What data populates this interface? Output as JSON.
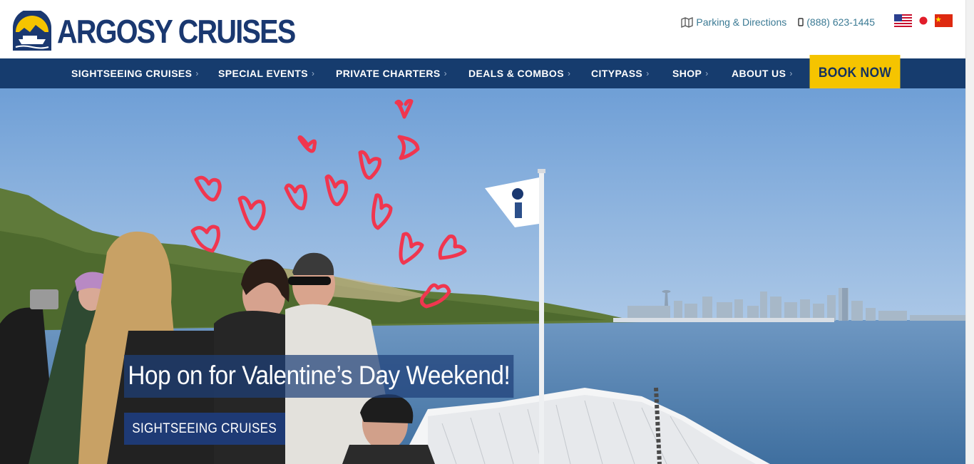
{
  "brand": {
    "name": "ARGOSY CRUISES",
    "primary_color": "#1a3870",
    "accent_color": "#f5c400"
  },
  "utility": {
    "parking_label": "Parking & Directions",
    "phone_label": "(888) 623-1445",
    "languages": [
      "us-flag-icon",
      "japan-flag-icon",
      "china-flag-icon"
    ]
  },
  "nav": {
    "items": [
      {
        "label": "SIGHTSEEING CRUISES"
      },
      {
        "label": "SPECIAL EVENTS"
      },
      {
        "label": "PRIVATE CHARTERS"
      },
      {
        "label": "DEALS & COMBOS"
      },
      {
        "label": "CITYPASS"
      },
      {
        "label": "SHOP"
      },
      {
        "label": "ABOUT US"
      }
    ],
    "book_label": "BOOK NOW"
  },
  "hero": {
    "title": "Hop on for Valentine’s Day Weekend!",
    "button_label": "SIGHTSEEING CRUISES"
  }
}
